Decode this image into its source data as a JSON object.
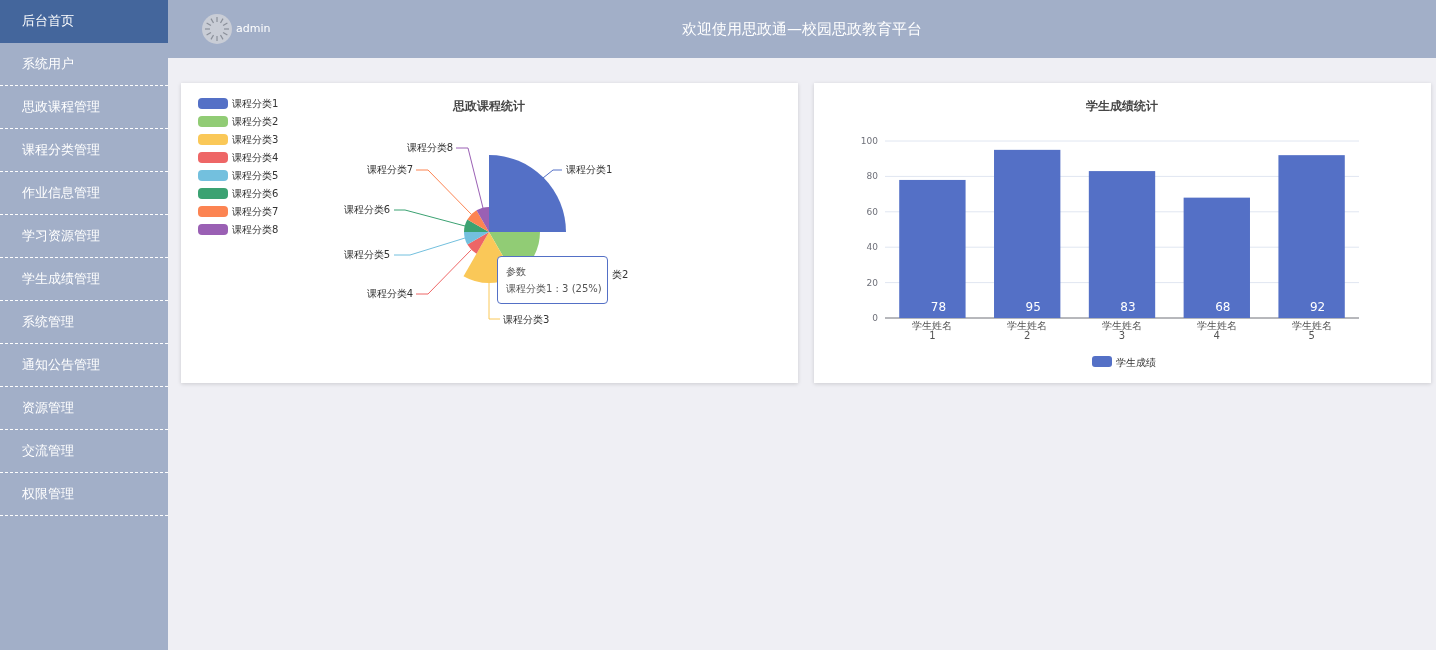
{
  "sidebar": {
    "items": [
      {
        "label": "后台首页",
        "selected": true
      },
      {
        "label": "系统用户",
        "selected": false
      },
      {
        "label": "思政课程管理",
        "selected": false
      },
      {
        "label": "课程分类管理",
        "selected": false
      },
      {
        "label": "作业信息管理",
        "selected": false
      },
      {
        "label": "学习资源管理",
        "selected": false
      },
      {
        "label": "学生成绩管理",
        "selected": false
      },
      {
        "label": "系统管理",
        "selected": false
      },
      {
        "label": "通知公告管理",
        "selected": false
      },
      {
        "label": "资源管理",
        "selected": false
      },
      {
        "label": "交流管理",
        "selected": false
      },
      {
        "label": "权限管理",
        "selected": false
      }
    ]
  },
  "header": {
    "user": "admin",
    "title": "欢迎使用思政通—校园思政教育平台"
  },
  "course_chart": {
    "title": "思政课程统计",
    "legend": [
      {
        "label": "课程分类1",
        "color": "#5470c6"
      },
      {
        "label": "课程分类2",
        "color": "#91cc75"
      },
      {
        "label": "课程分类3",
        "color": "#fac858"
      },
      {
        "label": "课程分类4",
        "color": "#ee6666"
      },
      {
        "label": "课程分类5",
        "color": "#73c0de"
      },
      {
        "label": "课程分类6",
        "color": "#3ba272"
      },
      {
        "label": "课程分类7",
        "color": "#fc8452"
      },
      {
        "label": "课程分类8",
        "color": "#9a60b4"
      }
    ],
    "slice_labels": [
      "课程分类8",
      "课程分类7",
      "课程分类1",
      "课程分类6",
      "课程分类5",
      "类2",
      "课程分类4",
      "课程分类3"
    ],
    "tooltip": {
      "title": "参数",
      "text": "课程分类1 : 3 (25%)"
    }
  },
  "score_chart": {
    "title": "学生成绩统计",
    "chart_data": {
      "type": "bar",
      "categories": [
        "学生姓名\n1",
        "学生姓名\n2",
        "学生姓名\n3",
        "学生姓名\n4",
        "学生姓名\n5"
      ],
      "series": [
        {
          "name": "学生成绩",
          "color": "#5470c6",
          "values": [
            78,
            95,
            83,
            68,
            92
          ]
        }
      ],
      "ylim": [
        0,
        100
      ],
      "yticks": [
        0,
        20,
        40,
        60,
        80,
        100
      ],
      "grid": true,
      "data_labels": true
    }
  }
}
